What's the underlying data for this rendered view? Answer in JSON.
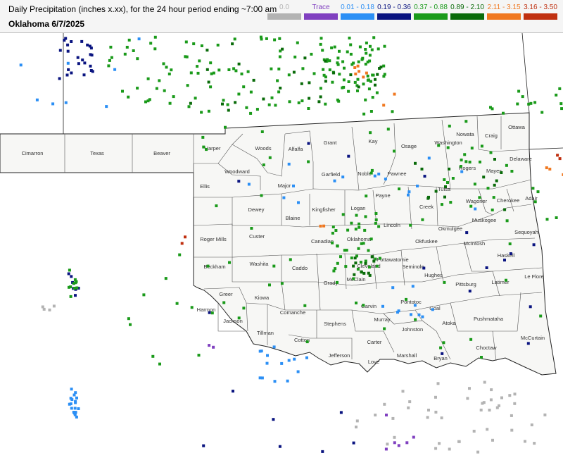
{
  "header": {
    "title": "Daily Precipitation (inches  x.xx),  for the 24 hour period ending ~7:00 am",
    "subtitle": "Oklahoma 6/7/2025"
  },
  "legend": [
    {
      "label": "0.0",
      "color": "#b3b3b3"
    },
    {
      "label": "Trace",
      "color": "#8040c0"
    },
    {
      "label": "0.01 - 0.18",
      "color": "#2b8ff5"
    },
    {
      "label": "0.19 - 0.36",
      "color": "#0a1480"
    },
    {
      "label": "0.37 - 0.88",
      "color": "#1a9a1a"
    },
    {
      "label": "0.89 - 2.10",
      "color": "#0a6b0a"
    },
    {
      "label": "2.11 - 3.15",
      "color": "#f07820"
    },
    {
      "label": "3.16 - 3.50",
      "color": "#c03010"
    }
  ],
  "map": {
    "state_fill": "#f7f7f5",
    "boundary_color": "#222222",
    "counties": [
      "Cimarron",
      "Texas",
      "Beaver",
      "Harper",
      "Woods",
      "Alfalfa",
      "Grant",
      "Kay",
      "Osage",
      "Washington",
      "Nowata",
      "Craig",
      "Ottawa",
      "Delaware",
      "Rogers",
      "Mayes",
      "Woodward",
      "Major",
      "Garfield",
      "Noble",
      "Pawnee",
      "Tulsa",
      "Wagoner",
      "Cherokee",
      "Adair",
      "Ellis",
      "Dewey",
      "Blaine",
      "Kingfisher",
      "Logan",
      "Payne",
      "Creek",
      "Okmulgee",
      "Muskogee",
      "Sequoyah",
      "Roger Mills",
      "Custer",
      "Canadian",
      "Oklahoma",
      "Lincoln",
      "Okfuskee",
      "McIntosh",
      "Haskell",
      "Beckham",
      "Washita",
      "Caddo",
      "Grady",
      "McClain",
      "Cleveland",
      "Pottawatomie",
      "Seminole",
      "Hughes",
      "Pittsburg",
      "Latimer",
      "Le Flore",
      "Greer",
      "Kiowa",
      "Harmon",
      "Jackson",
      "Comanche",
      "Tillman",
      "Cotton",
      "Stephens",
      "Garvin",
      "Pontotoc",
      "Murray",
      "Coal",
      "Atoka",
      "Pushmataha",
      "Johnston",
      "Carter",
      "Jefferson",
      "Love",
      "Marshall",
      "Bryan",
      "Choctaw",
      "McCurtain"
    ],
    "stations": [
      {
        "cat": 0,
        "n": 46,
        "region": [
          [
            500,
            540,
            780,
            640
          ]
        ]
      },
      {
        "cat": 0,
        "n": 4,
        "region": [
          [
            55,
            425,
            75,
            440
          ]
        ]
      },
      {
        "cat": 1,
        "n": 6,
        "region": [
          [
            540,
            570,
            620,
            640
          ]
        ]
      },
      {
        "cat": 1,
        "n": 2,
        "region": [
          [
            295,
            480,
            310,
            505
          ]
        ]
      },
      {
        "cat": 2,
        "n": 18,
        "region": [
          [
            95,
            550,
            110,
            590
          ]
        ]
      },
      {
        "cat": 2,
        "n": 14,
        "region": [
          [
            360,
            490,
            440,
            540
          ]
        ]
      },
      {
        "cat": 2,
        "n": 16,
        "region": [
          [
            300,
            220,
            700,
            300
          ]
        ]
      },
      {
        "cat": 2,
        "n": 8,
        "region": [
          [
            20,
            50,
            200,
            150
          ]
        ]
      },
      {
        "cat": 2,
        "n": 10,
        "region": [
          [
            540,
            400,
            620,
            450
          ]
        ]
      },
      {
        "cat": 3,
        "n": 24,
        "region": [
          [
            80,
            50,
            140,
            110
          ]
        ]
      },
      {
        "cat": 3,
        "n": 8,
        "region": [
          [
            95,
            380,
            110,
            420
          ]
        ]
      },
      {
        "cat": 3,
        "n": 16,
        "region": [
          [
            280,
            200,
            760,
            560
          ]
        ]
      },
      {
        "cat": 3,
        "n": 6,
        "region": [
          [
            280,
            580,
            560,
            640
          ]
        ]
      },
      {
        "cat": 4,
        "n": 120,
        "region": [
          [
            150,
            50,
            560,
            160
          ]
        ]
      },
      {
        "cat": 4,
        "n": 40,
        "region": [
          [
            450,
            60,
            530,
            130
          ]
        ]
      },
      {
        "cat": 4,
        "n": 40,
        "region": [
          [
            470,
            300,
            540,
            390
          ]
        ]
      },
      {
        "cat": 4,
        "n": 60,
        "region": [
          [
            280,
            170,
            800,
            520
          ]
        ]
      },
      {
        "cat": 4,
        "n": 20,
        "region": [
          [
            620,
            200,
            700,
            300
          ]
        ]
      },
      {
        "cat": 4,
        "n": 14,
        "region": [
          [
            690,
            120,
            800,
            160
          ]
        ]
      },
      {
        "cat": 4,
        "n": 10,
        "region": [
          [
            95,
            380,
            112,
            420
          ]
        ]
      },
      {
        "cat": 4,
        "n": 10,
        "region": [
          [
            180,
            350,
            290,
            530
          ]
        ]
      },
      {
        "cat": 5,
        "n": 30,
        "region": [
          [
            260,
            60,
            560,
            160
          ]
        ]
      },
      {
        "cat": 5,
        "n": 12,
        "region": [
          [
            500,
            360,
            540,
            390
          ]
        ]
      },
      {
        "cat": 5,
        "n": 14,
        "region": [
          [
            560,
            220,
            720,
            300
          ]
        ]
      },
      {
        "cat": 6,
        "n": 6,
        "region": [
          [
            490,
            90,
            520,
            110
          ]
        ]
      },
      {
        "cat": 6,
        "n": 3,
        "region": [
          [
            760,
            230,
            800,
            250
          ]
        ]
      },
      {
        "cat": 6,
        "n": 2,
        "region": [
          [
            450,
            310,
            470,
            330
          ]
        ]
      },
      {
        "cat": 6,
        "n": 2,
        "region": [
          [
            540,
            130,
            560,
            150
          ]
        ]
      },
      {
        "cat": 7,
        "n": 2,
        "region": [
          [
            250,
            330,
            262,
            345
          ]
        ]
      },
      {
        "cat": 7,
        "n": 2,
        "region": [
          [
            780,
            215,
            795,
            225
          ]
        ]
      }
    ]
  }
}
